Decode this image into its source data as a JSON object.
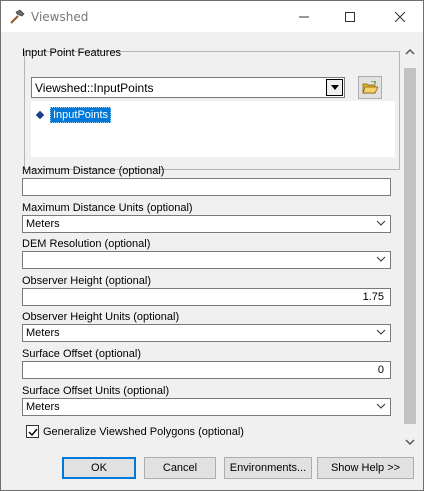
{
  "window": {
    "title": "Viewshed"
  },
  "params": {
    "input_label": "Input Point Features",
    "input_value": "Viewshed::InputPoints",
    "input_list": [
      "InputPoints"
    ],
    "max_dist_label": "Maximum Distance (optional)",
    "max_dist_value": "",
    "max_dist_units_label": "Maximum Distance Units (optional)",
    "max_dist_units_value": "Meters",
    "dem_label": "DEM Resolution (optional)",
    "dem_value": "",
    "obs_height_label": "Observer Height (optional)",
    "obs_height_value": "1.75",
    "obs_units_label": "Observer Height Units (optional)",
    "obs_units_value": "Meters",
    "surface_offset_label": "Surface Offset (optional)",
    "surface_offset_value": "0",
    "surface_units_label": "Surface Offset Units (optional)",
    "surface_units_value": "Meters",
    "generalize_label": "Generalize Viewshed Polygons (optional)",
    "generalize_checked": true
  },
  "buttons": {
    "ok": "OK",
    "cancel": "Cancel",
    "environments": "Environments...",
    "show_help": "Show Help >>"
  },
  "icons": {
    "app": "hammer-icon",
    "minimize": "minimize-icon",
    "maximize": "maximize-icon",
    "close": "close-icon",
    "folder": "open-folder-icon"
  },
  "colors": {
    "selection": "#0078d7",
    "folder_yellow": "#e8b530"
  }
}
